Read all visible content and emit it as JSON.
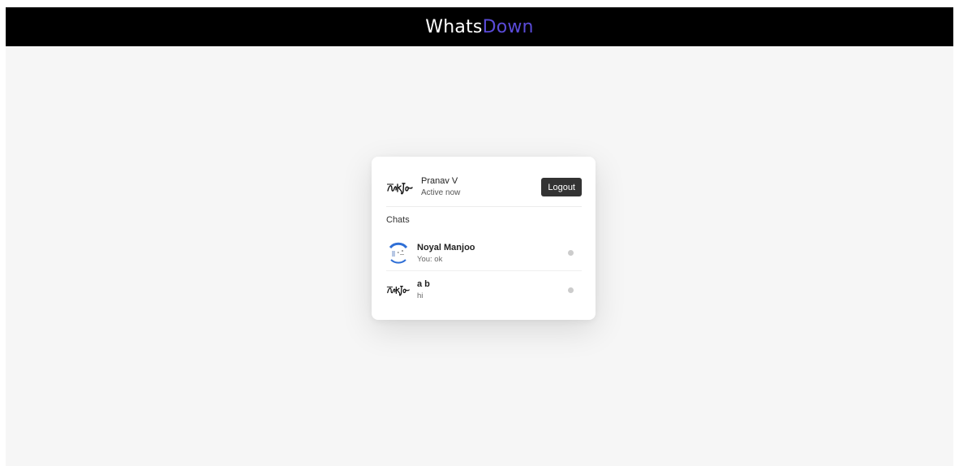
{
  "header": {
    "brand_primary": "Whats",
    "brand_accent": "Down",
    "accent_color": "#5a4bd8",
    "background_color": "#000000"
  },
  "user": {
    "name": "Pranav V",
    "status": "Active now",
    "avatar_icon": "signature-avatar-icon"
  },
  "actions": {
    "logout_label": "Logout"
  },
  "chats": {
    "section_title": "Chats",
    "items": [
      {
        "name": "Noyal Manjoo",
        "preview": "You: ok",
        "avatar_icon": "profile-photo-avatar-icon",
        "status_color": "#cccccc"
      },
      {
        "name": "a b",
        "preview": "hi",
        "avatar_icon": "signature-avatar-icon",
        "status_color": "#cccccc"
      }
    ]
  }
}
